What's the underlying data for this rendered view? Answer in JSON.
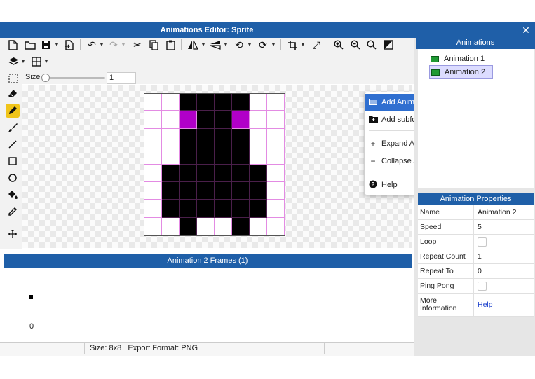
{
  "window": {
    "title": "Animations Editor: Sprite",
    "close_glyph": "✕"
  },
  "toolbar": {
    "icons": [
      "new-file-icon",
      "open-folder-icon",
      "save-icon",
      "export-icon",
      "undo-icon",
      "redo-icon",
      "cut-icon",
      "copy-icon",
      "paste-icon",
      "flip-horizontal-icon",
      "flip-vertical-icon",
      "rotate-left-icon",
      "rotate-right-icon",
      "crop-icon",
      "resize-icon",
      "zoom-in-icon",
      "zoom-out-icon",
      "zoom-fit-icon",
      "fill-mode-icon",
      "layers-icon",
      "grid-icon",
      "selection-icon"
    ],
    "size_label": "Size",
    "size_value": "1",
    "size_slider_fraction": 0.0
  },
  "tools": [
    "eraser-icon",
    "pencil-icon",
    "brush-icon",
    "line-icon",
    "rectangle-icon",
    "ellipse-icon",
    "fill-bucket-icon",
    "eyedropper-icon",
    "move-icon"
  ],
  "sprite": {
    "colors": {
      "0": "#ffffff",
      "1": "#000000",
      "2": "#b100c8"
    },
    "rows": [
      "00111100",
      "00211200",
      "00111100",
      "00111100",
      "01111110",
      "01111110",
      "01111110",
      "00100100"
    ]
  },
  "context_menu": {
    "items": [
      {
        "label": "Add Animation",
        "icon": "add-animation-icon",
        "selected": true
      },
      {
        "label": "Add subfolder",
        "icon": "add-folder-icon",
        "selected": false
      },
      {
        "label": "Expand All",
        "icon": "plus-icon",
        "selected": false
      },
      {
        "label": "Collapse All",
        "icon": "minus-icon",
        "selected": false
      },
      {
        "label": "Help",
        "icon": "help-icon",
        "selected": false
      }
    ]
  },
  "frames_panel": {
    "title": "Animation 2 Frames (1)",
    "frame_number": "0"
  },
  "status": {
    "text": "Size: 8x8   Export Format: PNG"
  },
  "animations_panel": {
    "title": "Animations",
    "items": [
      {
        "label": "Animation 1"
      },
      {
        "label": "Animation 2"
      }
    ]
  },
  "properties_panel": {
    "title": "Animation Properties",
    "rows": [
      {
        "name": "Name",
        "value": "Animation 2"
      },
      {
        "name": "Speed",
        "value": "5"
      },
      {
        "name": "Loop",
        "checked": false
      },
      {
        "name": "Repeat Count",
        "value": "1"
      },
      {
        "name": "Repeat To",
        "value": "0"
      },
      {
        "name": "Ping Pong",
        "checked": false
      },
      {
        "name": "More Information",
        "link": "Help"
      }
    ]
  }
}
